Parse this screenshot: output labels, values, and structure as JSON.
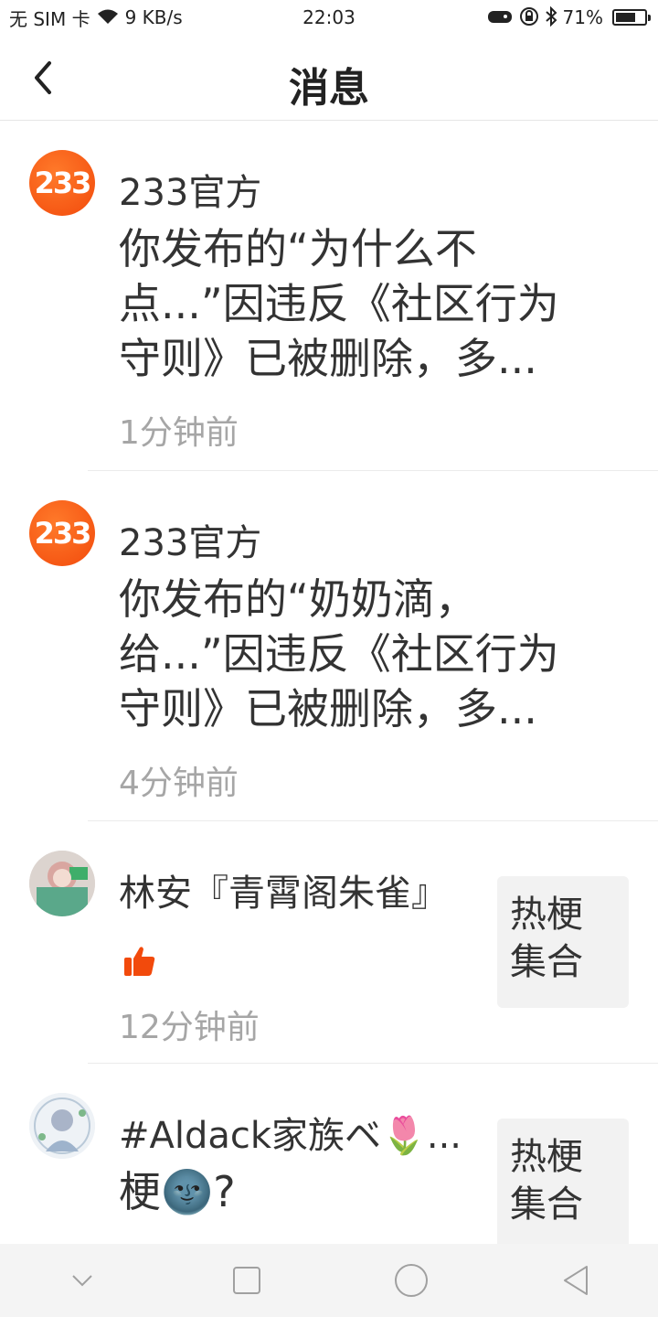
{
  "status_bar": {
    "carrier": "无 SIM 卡",
    "net_speed": "9 KB/s",
    "time": "22:03",
    "battery": "71%",
    "battery_level": 0.71
  },
  "header": {
    "title": "消息"
  },
  "messages": [
    {
      "avatar_text": "233",
      "name": "233官方",
      "body": "你发布的“为什么不点...”因违反《社区行为守则》已被删除，多...",
      "time": "1分钟前"
    },
    {
      "avatar_text": "233",
      "name": "233官方",
      "body": "你发布的“奶奶滴，给...”因违反《社区行为守则》已被删除，多...",
      "time": "4分钟前"
    },
    {
      "name": "林安『青霄阁朱雀』",
      "icon": "thumbs-up-icon",
      "thumb_text": "热梗集合",
      "time": "12分钟前"
    },
    {
      "name": "#Aldack家族ベ🌷...",
      "body": "梗🌚?",
      "thumb_text": "热梗集合"
    }
  ],
  "colors": {
    "brand_orange": "#f24a0c",
    "text_primary": "#333333",
    "text_secondary": "#a6a6a6"
  }
}
